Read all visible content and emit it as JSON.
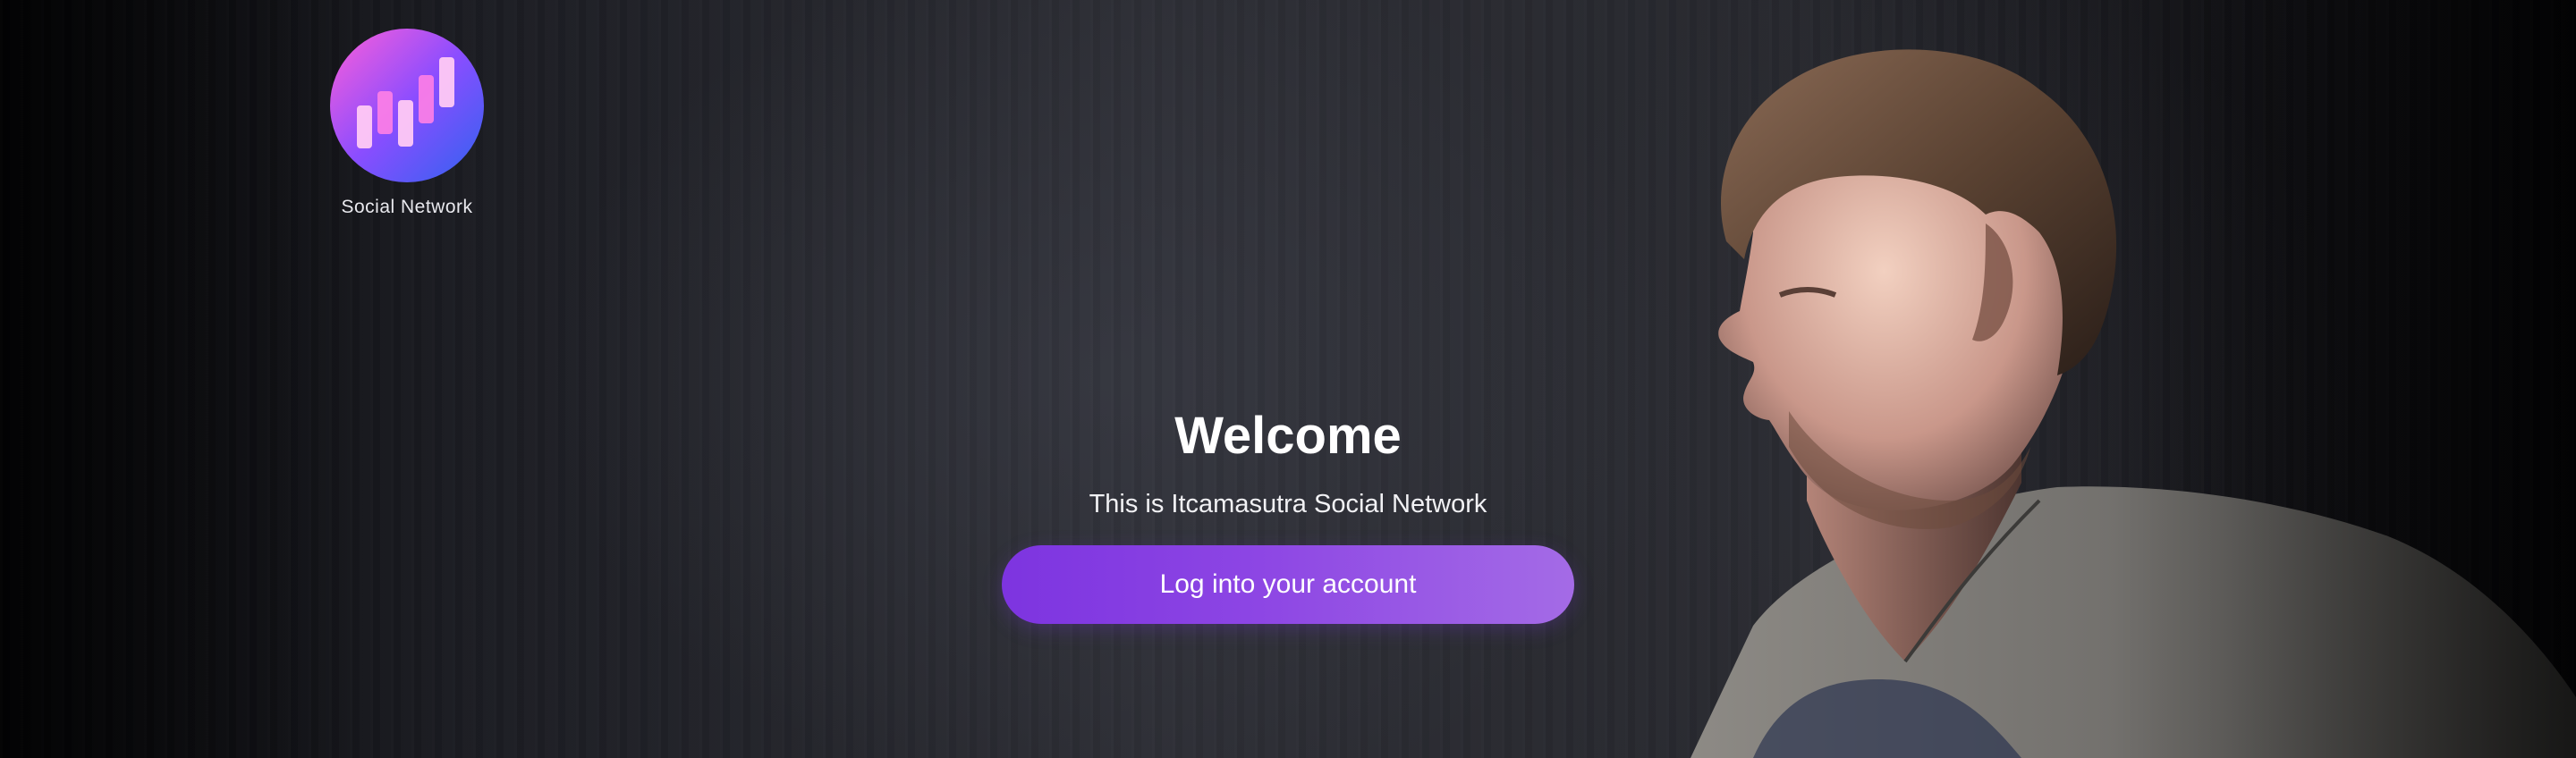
{
  "brand": {
    "name": "Social Network",
    "logo_icon": "bar-chart-logo-icon",
    "logo_colors": [
      "#ff5fd8",
      "#8b4dff",
      "#2f63f0"
    ]
  },
  "hero": {
    "title": "Welcome",
    "subtitle": "This is Itcamasutra Social Network",
    "login_button_label": "Log into your account",
    "button_colors": [
      "#7d34e0",
      "#a46be6"
    ]
  },
  "background": {
    "image": "man-profile-portrait"
  }
}
